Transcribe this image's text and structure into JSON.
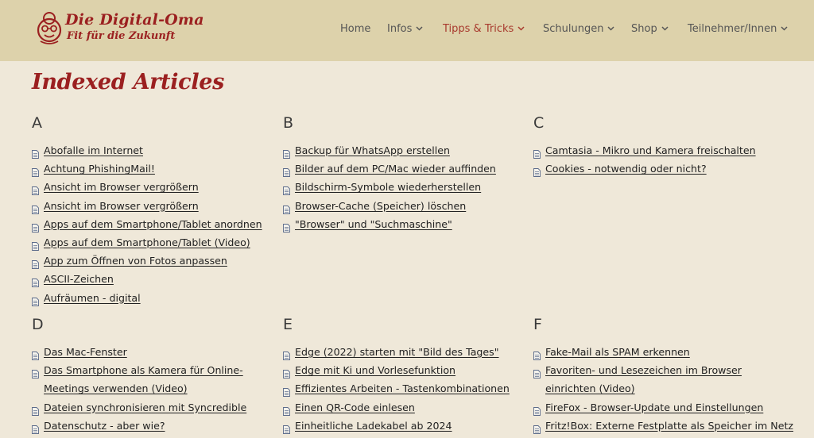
{
  "header": {
    "logo_line1": "Die Digital-Oma",
    "logo_line2": "Fit für die Zukunft",
    "nav": [
      {
        "label": "Home",
        "dropdown": false
      },
      {
        "label": "Infos",
        "dropdown": true
      },
      {
        "label": "Tipps & Tricks",
        "dropdown": true,
        "active": true
      },
      {
        "label": "Schulungen",
        "dropdown": true
      },
      {
        "label": "Shop",
        "dropdown": true
      },
      {
        "label": "Teilnehmer/Innen",
        "dropdown": true
      }
    ]
  },
  "page_title": "Indexed Articles",
  "sections": [
    {
      "letter": "A",
      "items": [
        "Abofalle im Internet",
        "Achtung PhishingMail!",
        "Ansicht im Browser vergrößern",
        "Ansicht im Browser vergrößern",
        "Apps auf dem Smartphone/Tablet anordnen",
        "Apps auf dem Smartphone/Tablet (Video)",
        "App zum Öffnen von Fotos anpassen",
        "ASCII-Zeichen",
        "Aufräumen - digital"
      ]
    },
    {
      "letter": "B",
      "items": [
        "Backup für WhatsApp erstellen",
        "Bilder auf dem PC/Mac wieder auffinden",
        "Bildschirm-Symbole wiederherstellen",
        "Browser-Cache (Speicher) löschen",
        "\"Browser\" und \"Suchmaschine\""
      ]
    },
    {
      "letter": "C",
      "items": [
        "Camtasia - Mikro und Kamera freischalten",
        "Cookies - notwendig oder nicht?"
      ]
    },
    {
      "letter": "D",
      "items": [
        "Das Mac-Fenster",
        "Das Smartphone als Kamera für Online-Meetings verwenden (Video)",
        "Dateien synchronisieren mit Syncredible",
        "Datenschutz - aber wie?"
      ]
    },
    {
      "letter": "E",
      "items": [
        "Edge (2022) starten mit \"Bild des Tages\"",
        "Edge mit Ki und Vorlesefunktion",
        "Effizientes Arbeiten - Tastenkombinationen",
        "Einen QR-Code einlesen",
        "Einheitliche Ladekabel ab 2024"
      ]
    },
    {
      "letter": "F",
      "items": [
        "Fake-Mail als SPAM erkennen",
        "Favoriten- und Lesezeichen im Browser einrichten (Video)",
        "FireFox - Browser-Update und Einstellungen",
        "Fritz!Box: Externe Festplatte als Speicher im Netz"
      ]
    }
  ],
  "colors": {
    "header_bg": "#ddd2ab",
    "page_bg": "#efe8d9",
    "accent": "#9b2020",
    "active_nav": "#a83a2e"
  },
  "icons": {
    "list_item": "document-icon",
    "nav_dropdown": "chevron-down-icon",
    "logo": "grandma-face-icon"
  }
}
